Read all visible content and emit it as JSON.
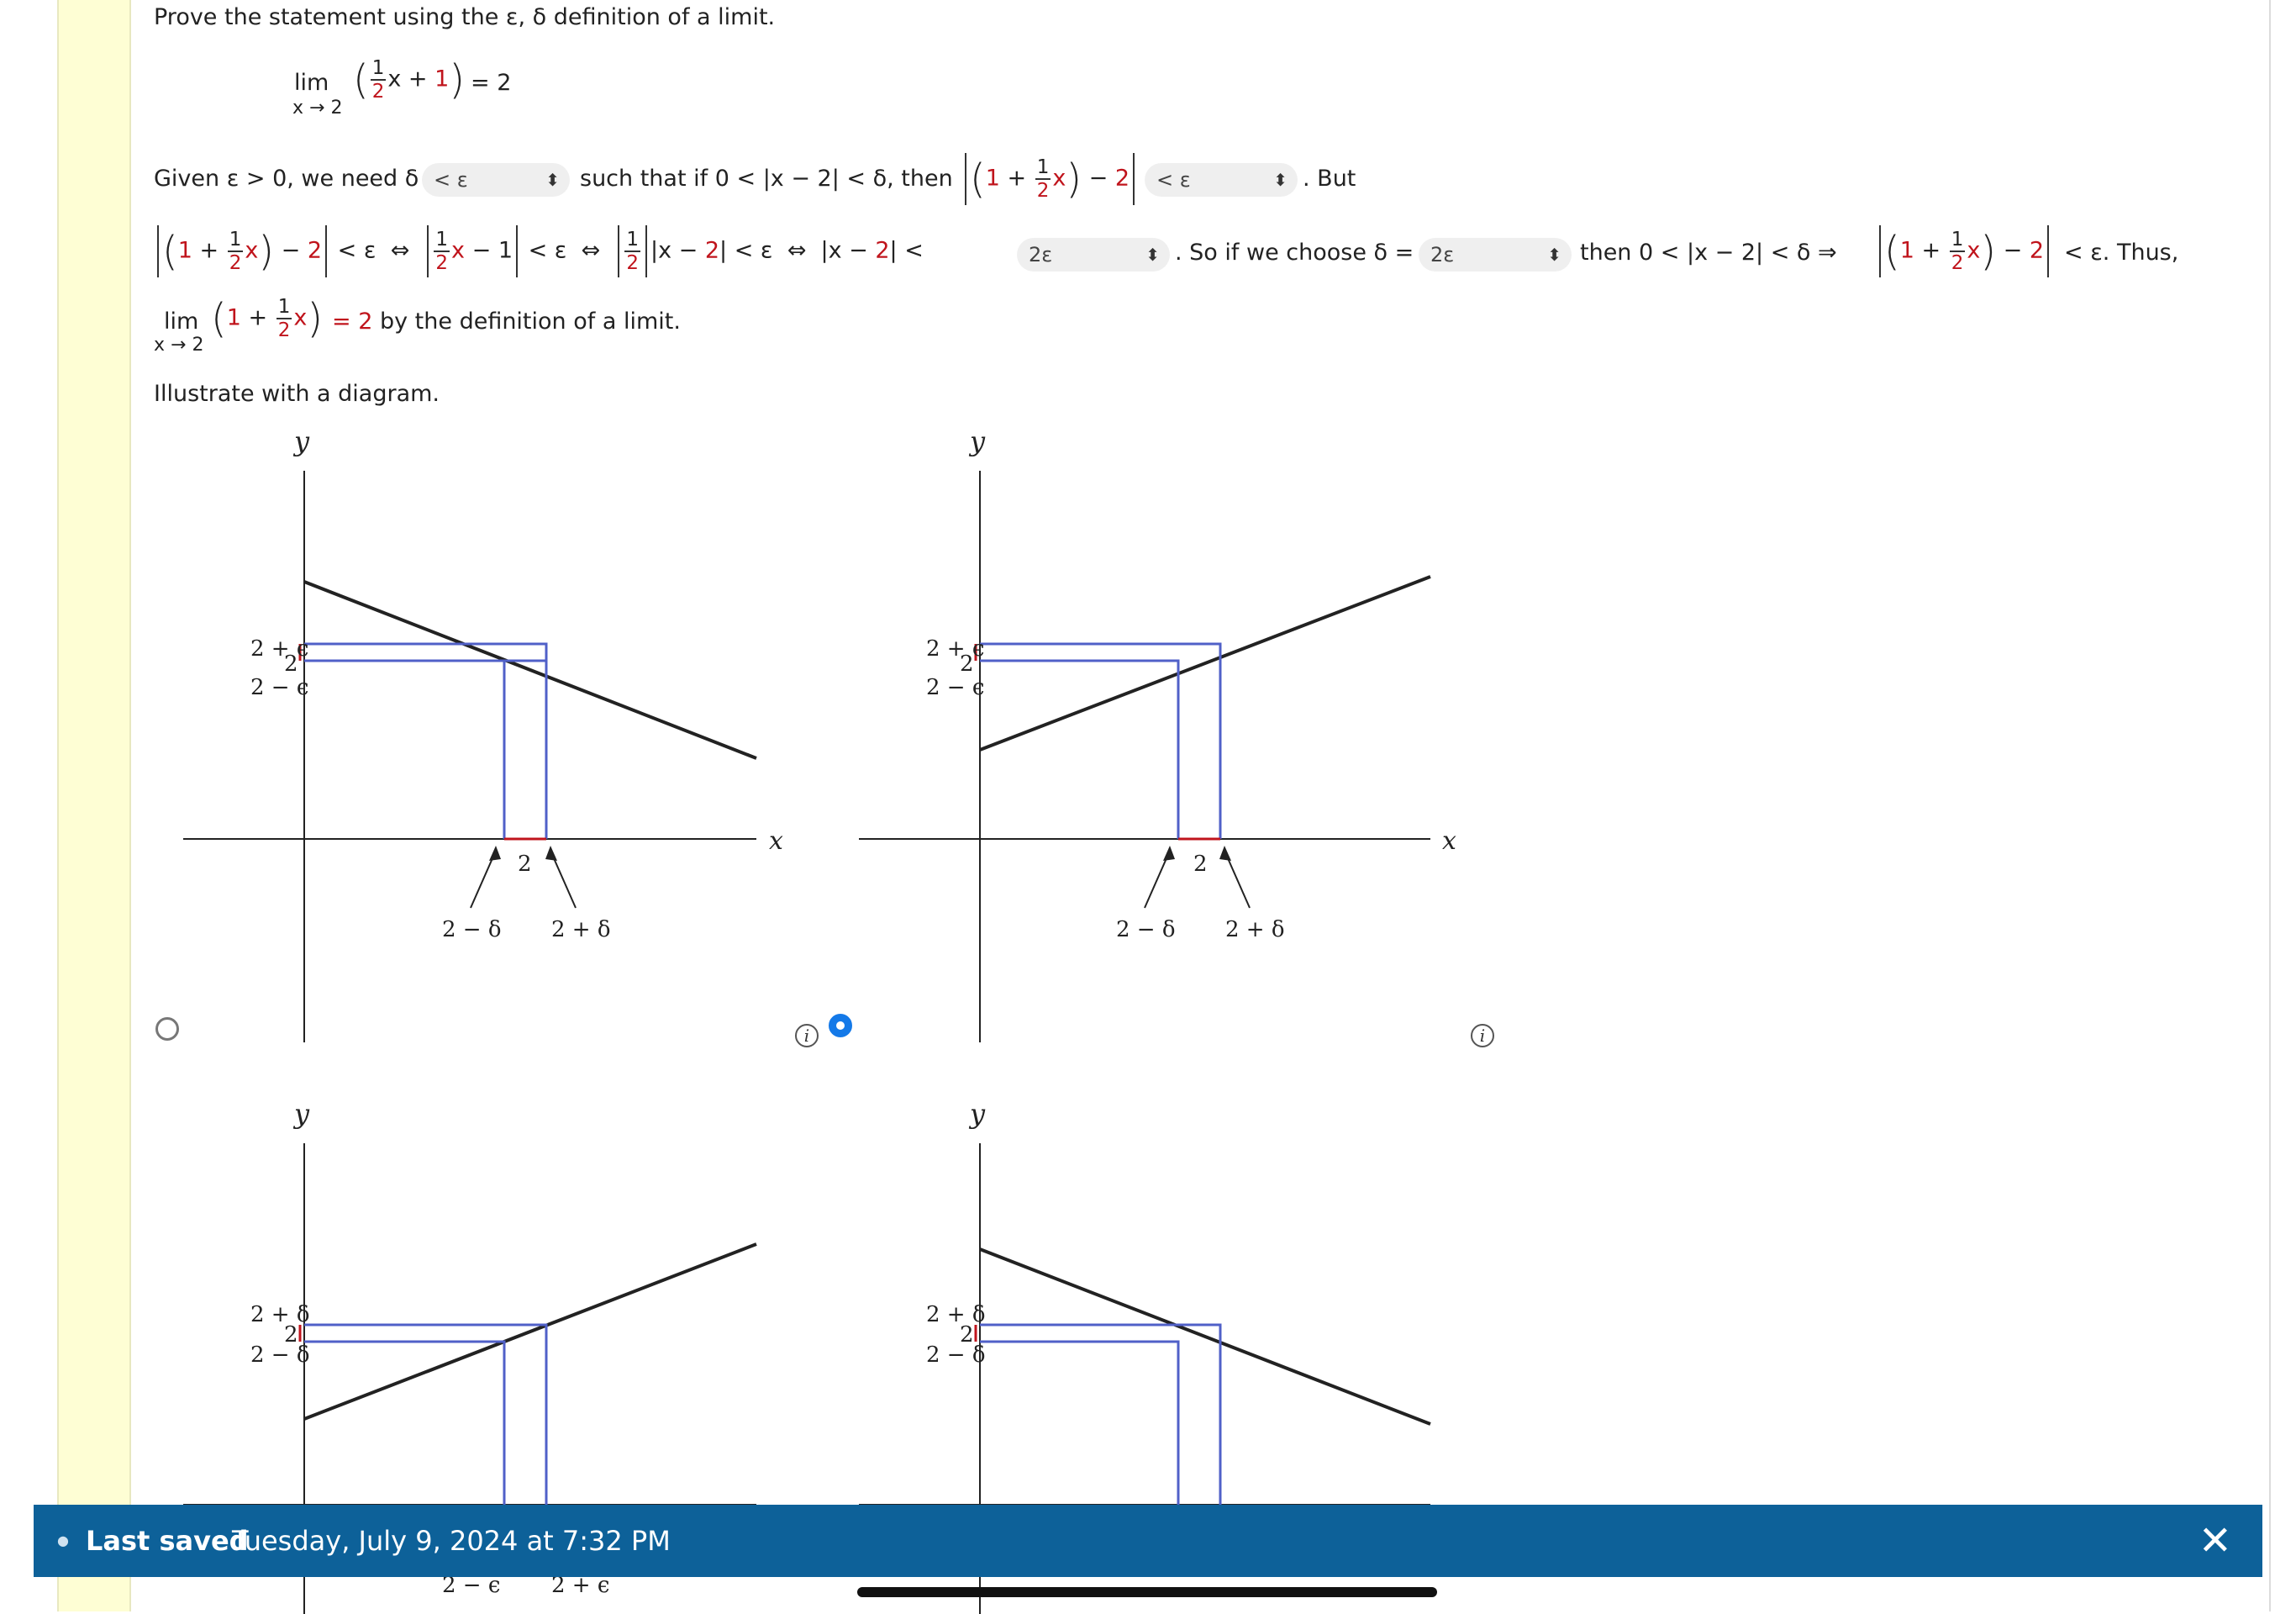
{
  "question": {
    "prompt": "Prove the statement using the ε, δ definition of a limit.",
    "limit": {
      "lim": "lim",
      "sub": "x → 2",
      "frac_num": "1",
      "frac_den": "2",
      "x_part": "x + ",
      "one": "1",
      "eq": "= 2"
    }
  },
  "proof": {
    "given": "Given ε > 0, we need δ",
    "dd1": "< ε",
    "such_that": "such that if 0 < |x − 2| < δ, then",
    "dd2": "< ε",
    "but": ". But",
    "dd3": "2ε",
    "so_if": ". So if we choose δ =",
    "dd4": "2ε",
    "then": "then 0 < |x − 2| < δ  ⇒",
    "thus": "< ε. Thus,",
    "conclusion": "= 2 by the definition of a limit.",
    "diagram_prompt": "Illustrate with a diagram."
  },
  "options": [
    {
      "id": "A",
      "selected": false,
      "eps_label": "ε"
    },
    {
      "id": "B",
      "selected": true,
      "eps_label": "ε"
    },
    {
      "id": "C",
      "selected": false,
      "eps_label": "δ"
    },
    {
      "id": "D",
      "selected": false,
      "eps_label": "δ"
    }
  ],
  "graph_labels": {
    "y": "y",
    "x": "x",
    "two": "2",
    "two_plus_eps": "2 + ϵ",
    "two_minus_eps": "2 − ϵ",
    "two_plus_delta": "2 + δ",
    "two_minus_delta": "2 − δ",
    "two_plus_eps_x": "2 + ϵ",
    "two_minus_eps_x": "2 − ϵ",
    "two_plus_delta_x": "2 + δ",
    "two_minus_delta_x": "2 − δ"
  },
  "colors": {
    "accent": "#1479e8",
    "status_bg": "#0d6199",
    "red": "#c0141c",
    "blue_box": "#5060c8"
  },
  "status": {
    "label": "Last saved",
    "value": "Tuesday, July 9, 2024 at 7:32 PM",
    "close": "✕"
  }
}
